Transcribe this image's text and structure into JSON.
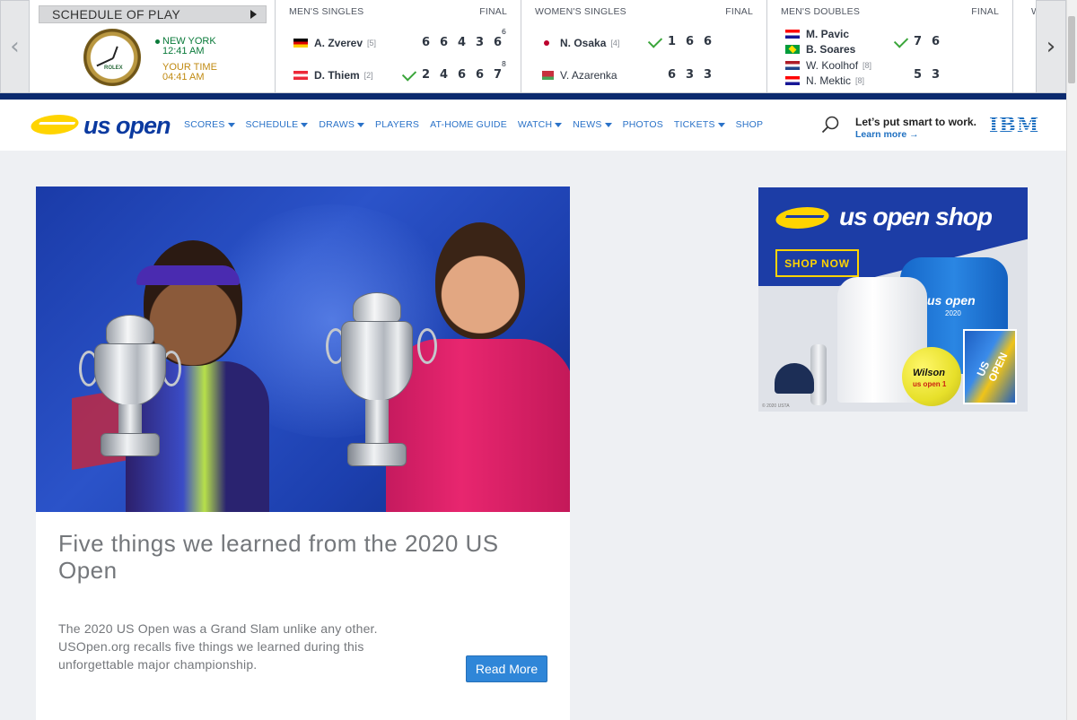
{
  "ticker": {
    "prev_arrow": "‹",
    "next_arrow": "›",
    "schedule": {
      "label": "SCHEDULE OF PLAY",
      "clock_brand": "ROLEX",
      "local_city": "NEW YORK",
      "local_time": "12:41 AM",
      "user_label": "YOUR TIME",
      "user_time": "04:41 AM"
    },
    "matches": [
      {
        "event": "MEN'S SINGLES",
        "status": "FINAL",
        "players": [
          {
            "name": "A. Zverev",
            "seed": "[5]",
            "flag": "de",
            "winner": false,
            "sets": [
              "6",
              "6",
              "4",
              "3",
              "6"
            ],
            "tiebreaks": [
              "",
              "",
              "",
              "",
              "6"
            ]
          },
          {
            "name": "D. Thiem",
            "seed": "[2]",
            "flag": "at",
            "winner": true,
            "sets": [
              "2",
              "4",
              "6",
              "6",
              "7"
            ],
            "tiebreaks": [
              "",
              "",
              "",
              "",
              "8"
            ]
          }
        ]
      },
      {
        "event": "WOMEN'S SINGLES",
        "status": "FINAL",
        "players": [
          {
            "name": "N. Osaka",
            "seed": "[4]",
            "flag": "jp",
            "winner": true,
            "sets": [
              "1",
              "6",
              "6"
            ],
            "tiebreaks": [
              "",
              "",
              ""
            ]
          },
          {
            "name": "V. Azarenka",
            "seed": "",
            "flag": "by",
            "winner": false,
            "sets": [
              "6",
              "3",
              "3"
            ],
            "tiebreaks": [
              "",
              "",
              ""
            ]
          }
        ]
      },
      {
        "event": "MEN'S DOUBLES",
        "status": "FINAL",
        "teams": [
          {
            "names": [
              {
                "name": "M. Pavic",
                "seed": "",
                "flag": "hr"
              },
              {
                "name": "B. Soares",
                "seed": "",
                "flag": "br"
              }
            ],
            "winner": true,
            "sets": [
              "7",
              "6"
            ]
          },
          {
            "names": [
              {
                "name": "W. Koolhof",
                "seed": "[8]",
                "flag": "nl"
              },
              {
                "name": "N. Mektic",
                "seed": "[8]",
                "flag": "hr"
              }
            ],
            "winner": false,
            "sets": [
              "5",
              "3"
            ]
          }
        ]
      }
    ],
    "partial_header": "W"
  },
  "nav": {
    "logo_text": "us open",
    "links": [
      {
        "label": "SCORES",
        "dropdown": true
      },
      {
        "label": "SCHEDULE",
        "dropdown": true
      },
      {
        "label": "DRAWS",
        "dropdown": true
      },
      {
        "label": "PLAYERS",
        "dropdown": false
      },
      {
        "label": "AT-HOME GUIDE",
        "dropdown": false
      },
      {
        "label": "WATCH",
        "dropdown": true
      },
      {
        "label": "NEWS",
        "dropdown": true
      },
      {
        "label": "PHOTOS",
        "dropdown": false
      },
      {
        "label": "TICKETS",
        "dropdown": true
      },
      {
        "label": "SHOP",
        "dropdown": false
      }
    ],
    "sponsor_tagline": "Let’s put smart to work.",
    "sponsor_link": "Learn more →",
    "sponsor_logo": "IBM"
  },
  "article": {
    "title": "Five things we learned from the 2020 US Open",
    "body": "The 2020 US Open was a Grand Slam unlike any other. USOpen.org recalls five things we learned during this unforgettable major championship.",
    "cta": "Read More"
  },
  "ad": {
    "title": "us open shop",
    "cta": "SHOP NOW",
    "shirt_text": "us open",
    "shirt_year": "2020",
    "ball_brand": "Wilson",
    "ball_sub": "us open 1",
    "bag_text": "US OPEN",
    "copyright": "© 2020 USTA"
  },
  "colors": {
    "brand_blue": "#0b3aa0",
    "link_blue": "#2a72c8",
    "accent_yellow": "#ffd400",
    "button_blue": "#2f86d8",
    "win_green": "#3aa53a"
  }
}
